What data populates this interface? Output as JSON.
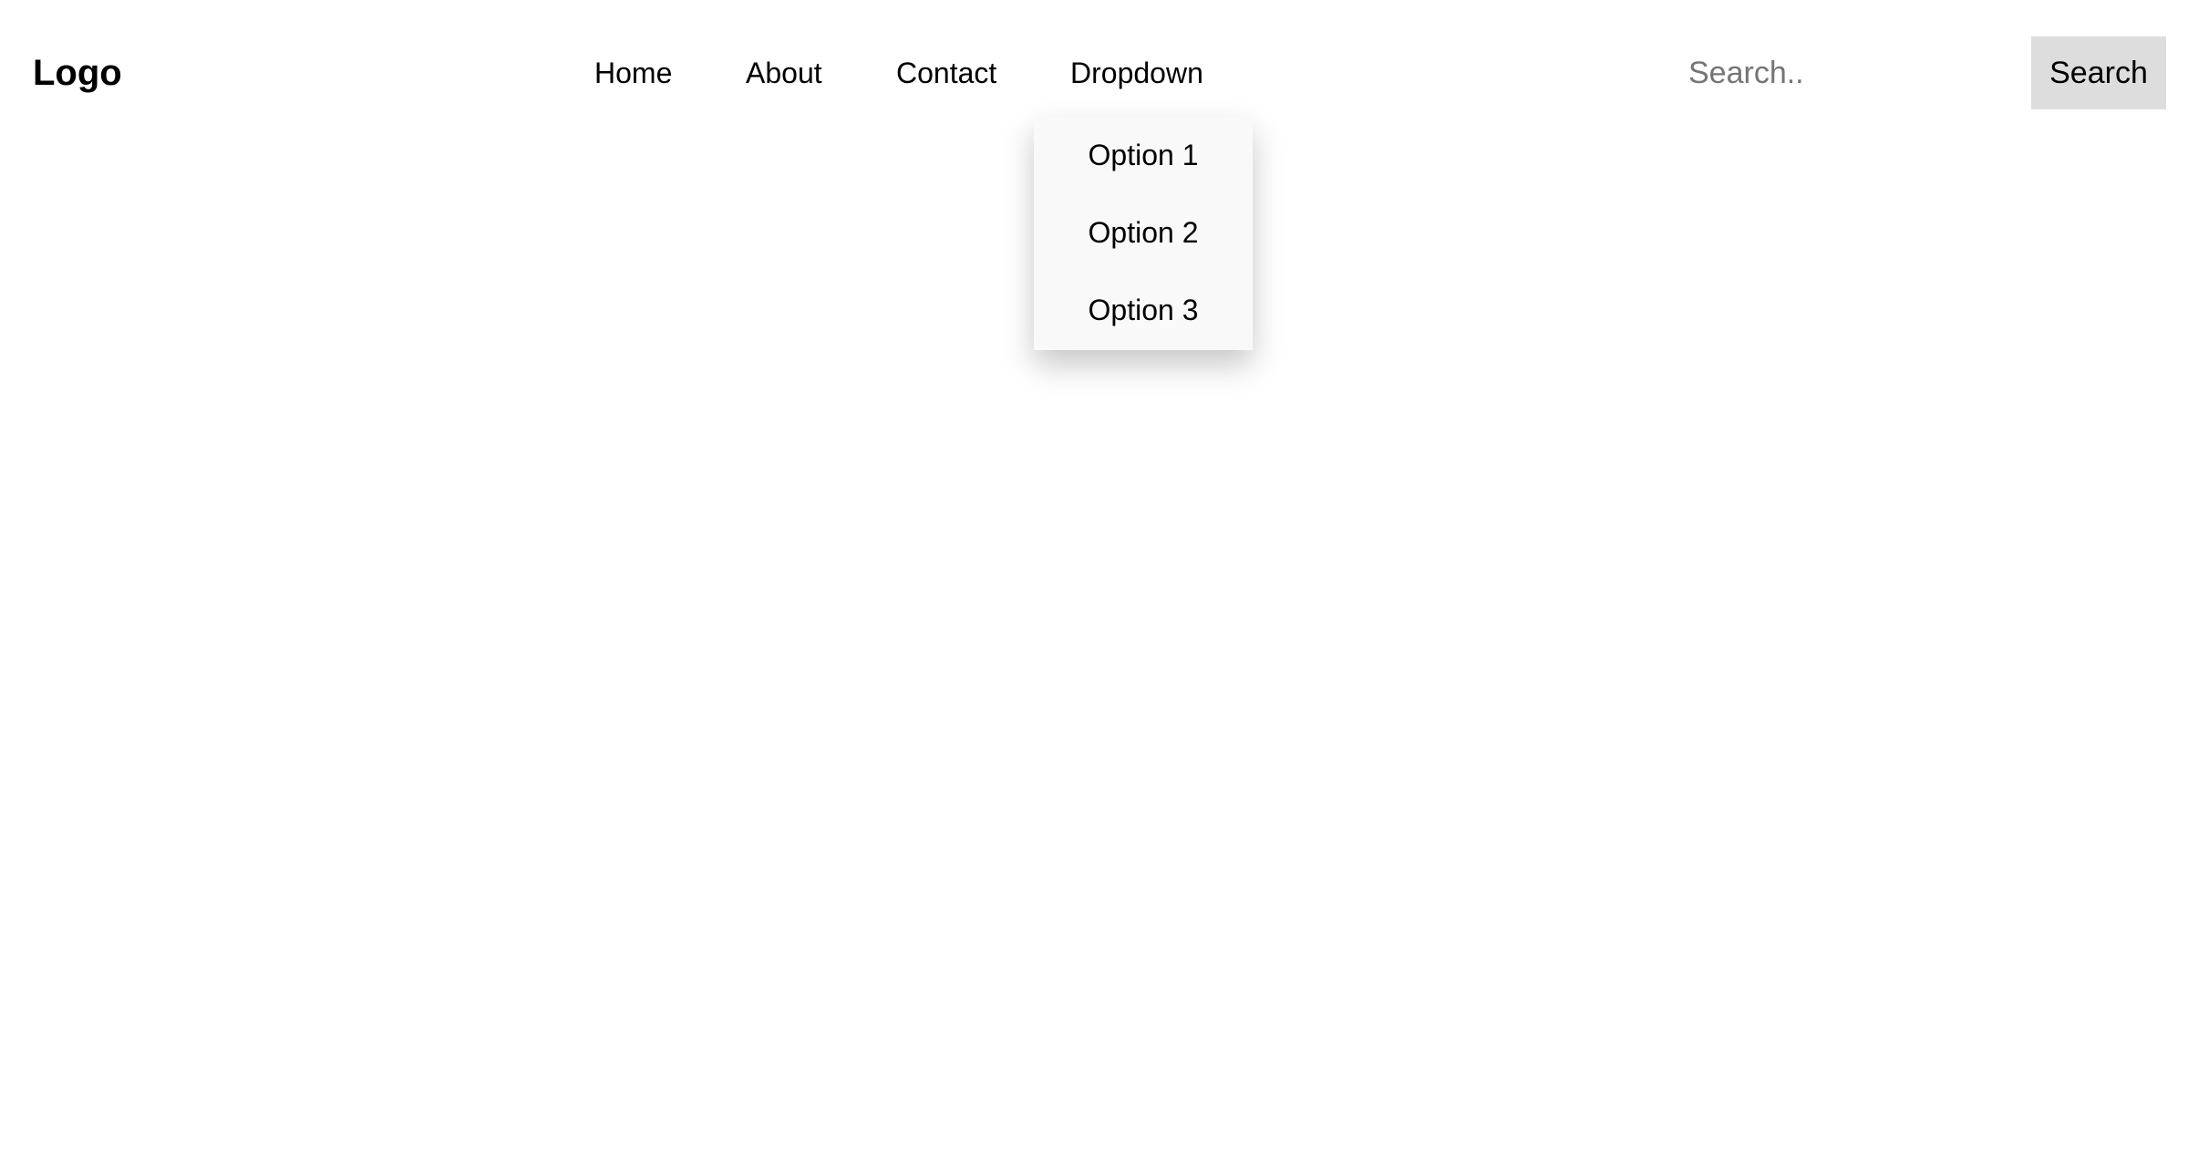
{
  "header": {
    "logo": "Logo",
    "nav": {
      "home": "Home",
      "about": "About",
      "contact": "Contact",
      "dropdown": "Dropdown"
    },
    "dropdown_options": [
      "Option 1",
      "Option 2",
      "Option 3"
    ],
    "search": {
      "placeholder": "Search..",
      "value": "",
      "button_label": "Search"
    }
  },
  "colors": {
    "background": "#ffffff",
    "text": "#000000",
    "dropdown_background": "#f9f9f9",
    "search_button_background": "#dddddd",
    "placeholder": "#757575"
  }
}
